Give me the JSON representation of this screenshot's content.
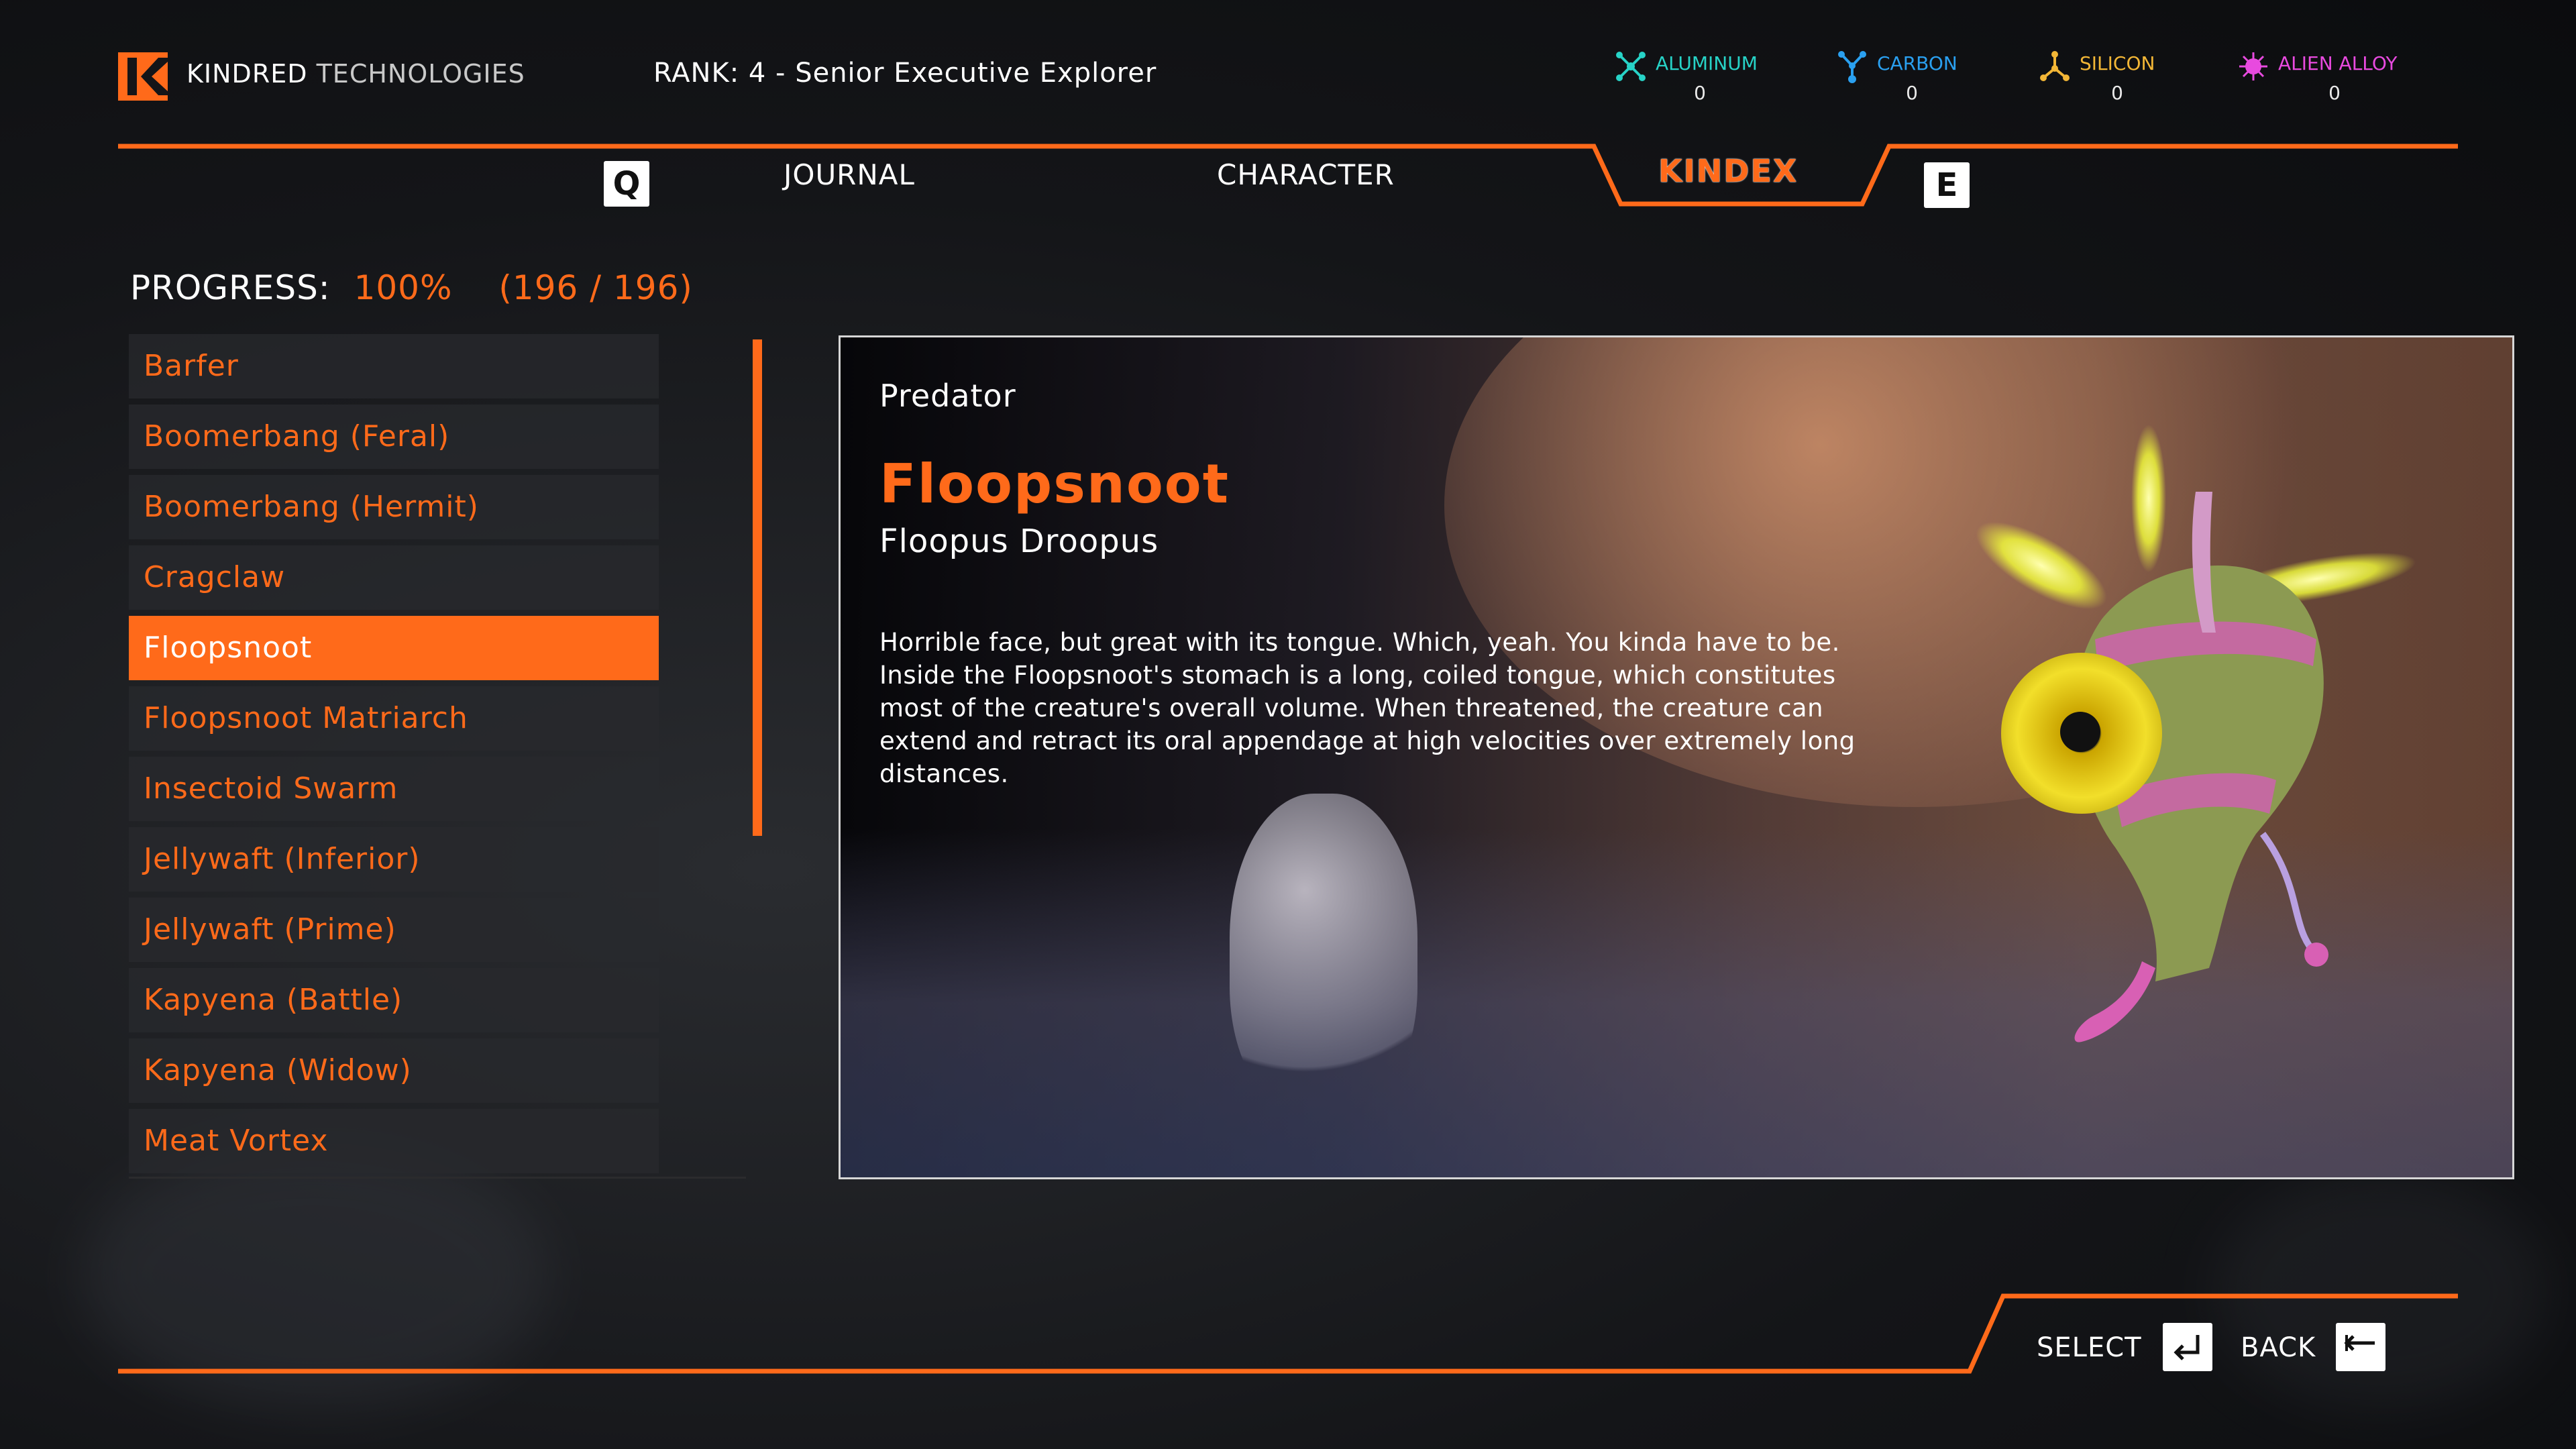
{
  "colors": {
    "accent": "#ff6a1a",
    "aluminum": "#27d3c7",
    "carbon": "#2aa0f0",
    "silicon": "#f2b636",
    "alien_alloy": "#e84adf"
  },
  "header": {
    "brand_primary": "KINDRED",
    "brand_secondary": "TECHNOLOGIES",
    "rank": "RANK: 4 - Senior Executive Explorer",
    "resources": [
      {
        "name": "ALUMINUM",
        "value": "0",
        "icon": "aluminum-molecule-icon"
      },
      {
        "name": "CARBON",
        "value": "0",
        "icon": "carbon-molecule-icon"
      },
      {
        "name": "SILICON",
        "value": "0",
        "icon": "silicon-molecule-icon"
      },
      {
        "name": "ALIEN ALLOY",
        "value": "0",
        "icon": "alien-alloy-icon"
      }
    ]
  },
  "tabs": {
    "prev_key": "Q",
    "next_key": "E",
    "items": [
      "JOURNAL",
      "CHARACTER",
      "KINDEX"
    ],
    "active": "KINDEX"
  },
  "progress": {
    "label": "PROGRESS:",
    "percent": "100%",
    "count": "(196 / 196)"
  },
  "creatures": [
    "Barfer",
    "Boomerbang (Feral)",
    "Boomerbang (Hermit)",
    "Cragclaw",
    "Floopsnoot",
    "Floopsnoot Matriarch",
    "Insectoid Swarm",
    "Jellywaft (Inferior)",
    "Jellywaft (Prime)",
    "Kapyena (Battle)",
    "Kapyena (Widow)",
    "Meat Vortex"
  ],
  "selected_index": 4,
  "detail": {
    "category": "Predator",
    "name": "Floopsnoot",
    "scientific_name": "Floopus Droopus",
    "description": "Horrible face, but great with its tongue. Which, yeah. You kinda have to be. Inside the Floopsnoot's stomach is a long, coiled tongue, which constitutes most of the creature's overall volume. When threatened, the creature can extend and retract its oral appendage at high velocities over extremely long distances."
  },
  "footer": {
    "select_label": "SELECT",
    "back_label": "BACK"
  }
}
